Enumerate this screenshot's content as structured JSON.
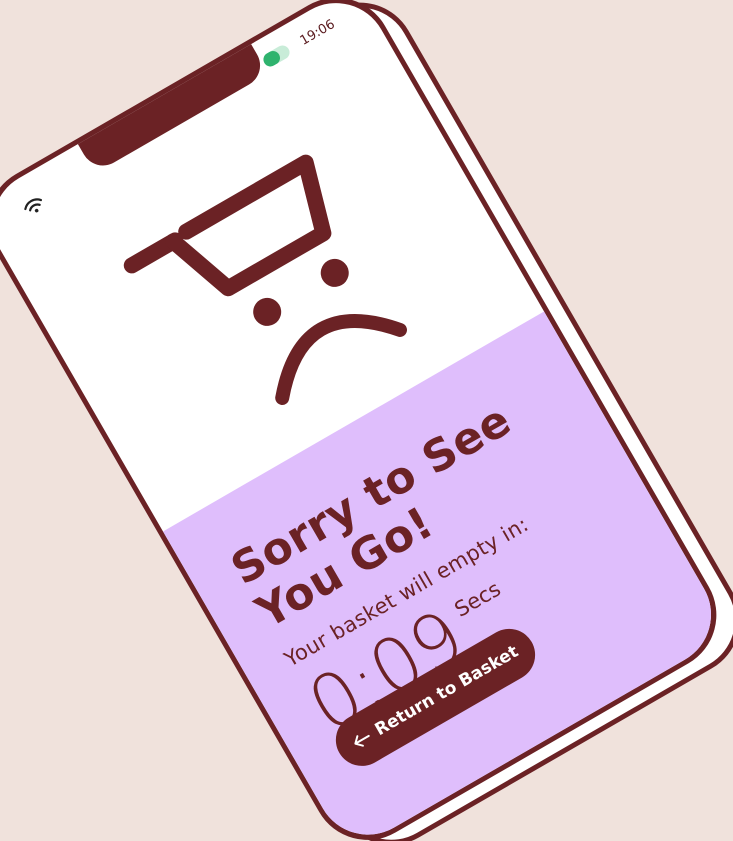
{
  "status_bar": {
    "time": "19:06",
    "battery_level": 0.6,
    "battery_color": "#2fb36e",
    "wifi_icon": "wifi-icon"
  },
  "hero": {
    "icon": "sad-cart-icon"
  },
  "message": {
    "headline_line1": "Sorry to See",
    "headline_line2": "You Go!",
    "subline": "Your basket will empty in:",
    "countdown": "0:09",
    "unit": "Secs"
  },
  "actions": {
    "return_label": "Return to Basket",
    "return_icon": "arrow-left-icon"
  },
  "colors": {
    "background": "#f0e2dc",
    "brand": "#6b2225",
    "panel": "#dfbefc",
    "screen": "#ffffff"
  }
}
